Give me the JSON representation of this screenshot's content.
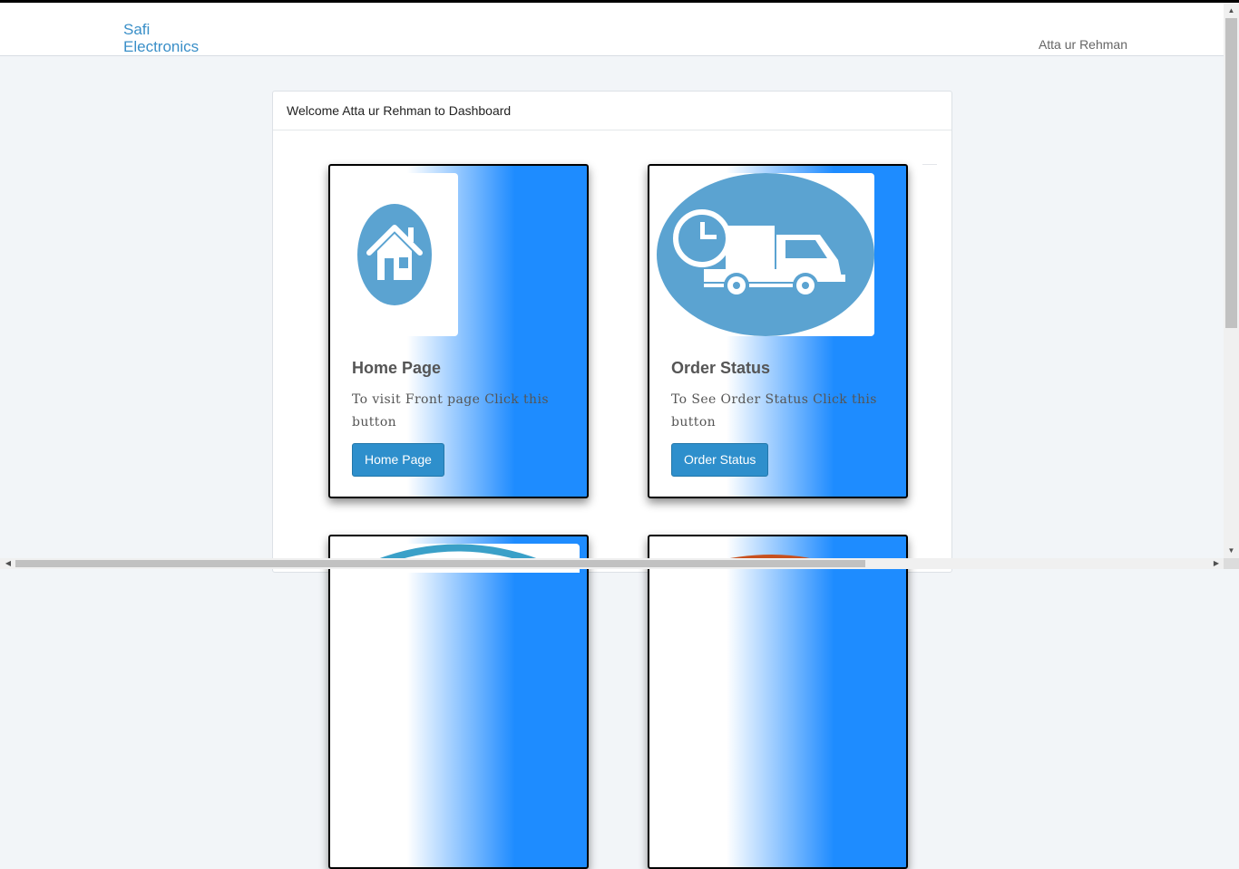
{
  "header": {
    "brand_line1": "Safi",
    "brand_line2": "Electronics",
    "user_name": "Atta ur Rehman"
  },
  "panel": {
    "heading": "Welcome Atta ur Rehman to Dashboard"
  },
  "cards": [
    {
      "title": "Home Page",
      "text": "To visit Front page Click this button",
      "button": "Home Page",
      "icon": "home-icon"
    },
    {
      "title": "Order Status",
      "text": "To See Order Status Click this button",
      "button": "Order Status",
      "icon": "delivery-truck-icon"
    }
  ],
  "colors": {
    "brand": "#3a8fc8",
    "card_gradient_end": "#1e8cff",
    "button": "#2e8fcc",
    "icon_circle": "#5ba3d1"
  }
}
